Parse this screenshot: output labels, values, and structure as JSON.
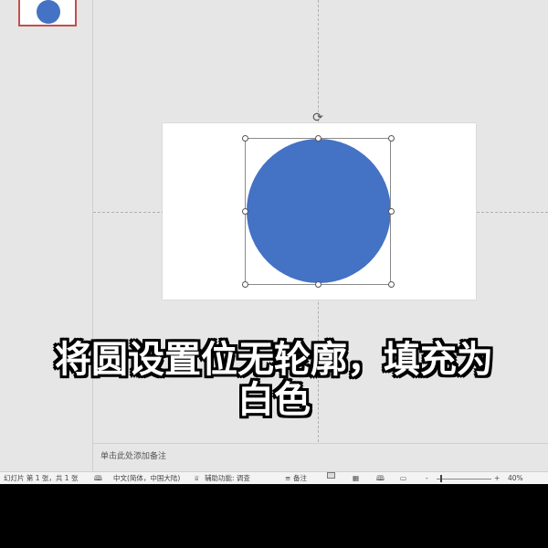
{
  "colors": {
    "shape_fill": "#4472c4",
    "accent": "#c0504d"
  },
  "caption": {
    "line1": "将圆设置位无轮廓，填充为",
    "line2": "白色"
  },
  "notes": {
    "placeholder": "单击此处添加备注"
  },
  "statusbar": {
    "slide_info": "幻灯片 第 1 张，共 1 张",
    "language": "中文(简体，中国大陆)",
    "accessibility": "辅助功能: 调查",
    "notes_label": "备注",
    "zoom_minus": "-",
    "zoom_plus": "+",
    "zoom_level": "40%"
  },
  "icons": {
    "rotate": "rotate-icon",
    "spell": "book-icon",
    "accessibility": "accessibility-icon",
    "notes": "notes-icon",
    "normal_view": "normal-view-icon",
    "sorter_view": "slide-sorter-icon",
    "reading_view": "reading-view-icon",
    "slideshow": "slideshow-icon"
  }
}
